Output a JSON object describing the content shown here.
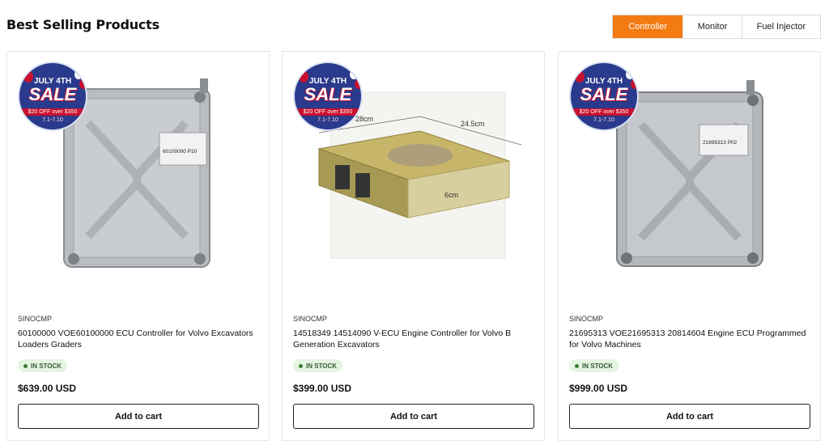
{
  "section": {
    "title": "Best Selling Products"
  },
  "tabs": [
    {
      "label": "Controller",
      "active": true
    },
    {
      "label": "Monitor",
      "active": false
    },
    {
      "label": "Fuel Injector",
      "active": false
    }
  ],
  "promo_badge": {
    "title": "JULY 4TH",
    "sale": "SALE",
    "deal": "$20 OFF over $350",
    "dates": "7.1-7.10"
  },
  "products": [
    {
      "vendor": "SINOCMP",
      "title": "60100000 VOE60100000 ECU Controller for Volvo Excavators Loaders Graders",
      "stock": "IN STOCK",
      "price": "$639.00 USD",
      "add_to_cart": "Add to cart",
      "image_label": "60100000   P10"
    },
    {
      "vendor": "SINOCMP",
      "title": "14518349 14514090 V-ECU Engine Controller for Volvo B Generation Excavators",
      "stock": "IN STOCK",
      "price": "$399.00 USD",
      "add_to_cart": "Add to cart",
      "dims": {
        "length": "28cm",
        "width": "24.5cm",
        "height": "6cm"
      }
    },
    {
      "vendor": "SINOCMP",
      "title": "21695313 VOE21695313 20814604 Engine ECU Programmed for Volvo Machines",
      "stock": "IN STOCK",
      "price": "$999.00 USD",
      "add_to_cart": "Add to cart",
      "image_label": "21695313   P02"
    }
  ],
  "colors": {
    "accent": "#f47a12",
    "badge_blue": "#2a3a8c",
    "badge_red": "#c8102e",
    "stock_bg": "#e5f4e3"
  }
}
